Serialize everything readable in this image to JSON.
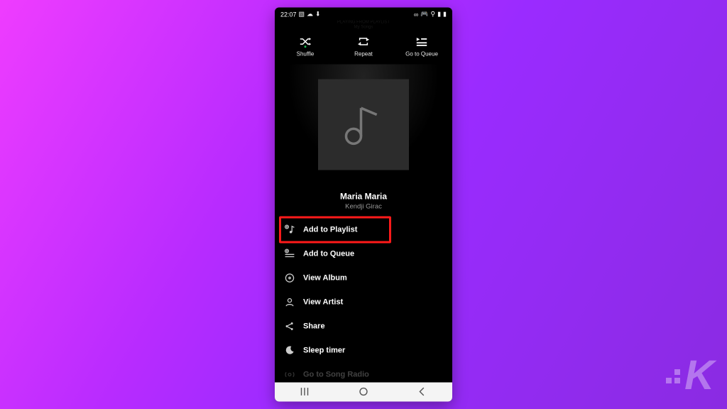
{
  "status": {
    "time": "22:07",
    "left_icons": [
      "image-icon",
      "cloud-icon",
      "download-icon"
    ],
    "right_icons": [
      "link-icon",
      "controller-icon",
      "wifi-icon",
      "signal-icon",
      "battery-icon"
    ]
  },
  "header": {
    "context_line": "PLAYING FROM PLAYLIST",
    "playlist_name": "My Songs"
  },
  "top_actions": {
    "shuffle": "Shuffle",
    "repeat": "Repeat",
    "go_to_queue": "Go to Queue"
  },
  "song": {
    "title": "Maria Maria",
    "artist": "Kendji Girac",
    "art_icon": "music-note-icon"
  },
  "menu": [
    {
      "icon": "add-to-playlist-icon",
      "label": "Add to Playlist",
      "highlighted": true
    },
    {
      "icon": "add-to-queue-icon",
      "label": "Add to Queue"
    },
    {
      "icon": "view-album-icon",
      "label": "View Album"
    },
    {
      "icon": "view-artist-icon",
      "label": "View Artist"
    },
    {
      "icon": "share-icon",
      "label": "Share"
    },
    {
      "icon": "sleep-timer-icon",
      "label": "Sleep timer"
    },
    {
      "icon": "radio-icon",
      "label": "Go to Song Radio",
      "partial": true
    }
  ],
  "nav": {
    "recent": "recent-icon",
    "home": "home-icon",
    "back": "back-icon"
  },
  "brand": {
    "letter": "K"
  }
}
